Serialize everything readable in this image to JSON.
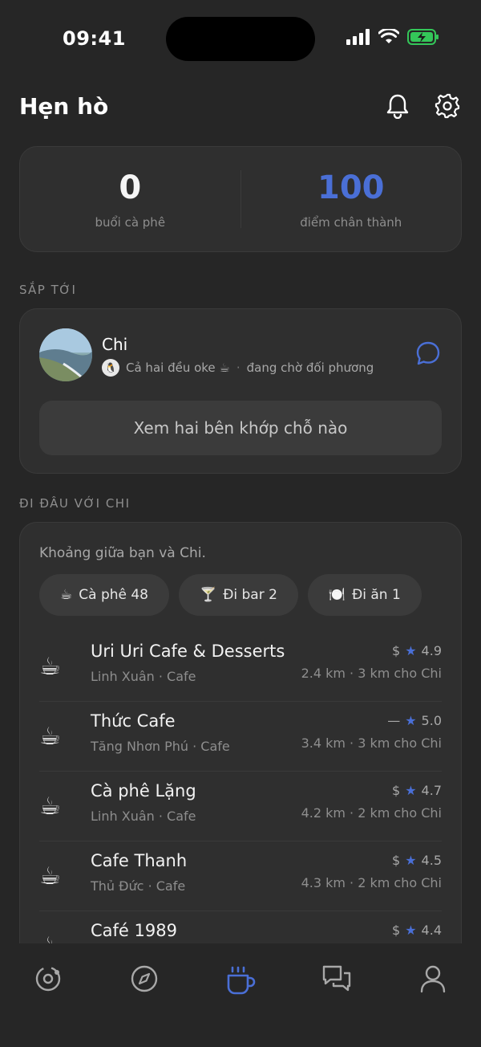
{
  "status_bar": {
    "time": "09:41"
  },
  "header": {
    "title": "Hẹn hò"
  },
  "stats": [
    {
      "value": "0",
      "label": "buổi cà phê"
    },
    {
      "value": "100",
      "label": "điểm chân thành"
    }
  ],
  "upcoming": {
    "section_label": "SẮP TỚI",
    "name": "Chi",
    "status_text": "Cả hai đều oke ☕",
    "status_separator": "·",
    "waiting_text": "đang chờ đối phương",
    "match_button": "Xem hai bên khớp chỗ nào"
  },
  "places": {
    "section_label": "ĐI ĐÂU VỚI CHI",
    "intro": "Khoảng giữa bạn và Chi.",
    "chips": [
      {
        "icon": "☕",
        "label": "Cà phê 48"
      },
      {
        "icon": "🍸",
        "label": "Đi bar 2"
      },
      {
        "icon": "🍽️",
        "label": "Đi ăn 1"
      }
    ],
    "items": [
      {
        "icon": "☕",
        "name": "Uri Uri Cafe & Desserts",
        "sub": "Linh Xuân · Cafe",
        "price": "$",
        "rating": "4.9",
        "distance": "2.4 km · 3 km cho Chi"
      },
      {
        "icon": "☕",
        "name": "Thức Cafe",
        "sub": "Tăng Nhơn Phú · Cafe",
        "price": "—",
        "rating": "5.0",
        "distance": "3.4 km · 3 km cho Chi"
      },
      {
        "icon": "☕",
        "name": "Cà phê Lặng",
        "sub": "Linh Xuân · Cafe",
        "price": "$",
        "rating": "4.7",
        "distance": "4.2 km · 2 km cho Chi"
      },
      {
        "icon": "☕",
        "name": "Cafe Thanh",
        "sub": "Thủ Đức · Cafe",
        "price": "$",
        "rating": "4.5",
        "distance": "4.3 km · 2 km cho Chi"
      },
      {
        "icon": "☕",
        "name": "Café 1989",
        "sub": "",
        "price": "$",
        "rating": "4.4",
        "distance": ""
      }
    ]
  },
  "tab_bar": {
    "tabs": [
      "orbit-icon",
      "compass-icon",
      "coffee-cup-icon",
      "chat-bubbles-icon",
      "profile-icon"
    ],
    "active_index": 2
  },
  "colors": {
    "accent": "#4a6fd6",
    "background": "#262626",
    "card": "#2f2f2f",
    "battery": "#34c759"
  }
}
